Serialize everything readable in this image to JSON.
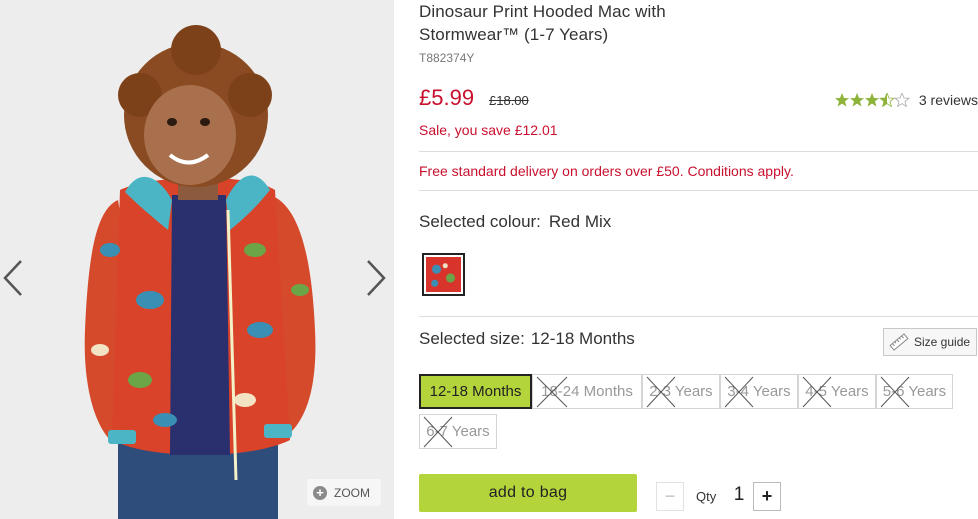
{
  "product": {
    "title": "Dinosaur Print Hooded Mac with Stormwear™ (1-7 Years)",
    "sku": "T882374Y",
    "price": "£5.99",
    "was_price": "£18.00",
    "save_text": "Sale, you save £12.01",
    "rating_value": 3.5,
    "rating_max": 5,
    "reviews_text": "3 reviews"
  },
  "delivery": {
    "text": "Free standard delivery on orders over £50. Conditions apply."
  },
  "colour": {
    "label": "Selected colour:",
    "value": "Red Mix",
    "swatch_icon": "red-mix-dinosaur-swatch"
  },
  "size": {
    "label": "Selected size:",
    "value": "12-18 Months",
    "guide_label": "Size guide",
    "options": [
      {
        "label": "12-18 Months",
        "available": true,
        "selected": true
      },
      {
        "label": "18-24 Months",
        "available": false,
        "selected": false
      },
      {
        "label": "2-3 Years",
        "available": false,
        "selected": false
      },
      {
        "label": "3-4 Years",
        "available": false,
        "selected": false
      },
      {
        "label": "4-5 Years",
        "available": false,
        "selected": false
      },
      {
        "label": "5-6 Years",
        "available": false,
        "selected": false
      },
      {
        "label": "6-7 Years",
        "available": false,
        "selected": false
      }
    ]
  },
  "gallery": {
    "zoom_label": "ZOOM",
    "prev_icon": "chevron-left-icon",
    "next_icon": "chevron-right-icon"
  },
  "actions": {
    "add_to_bag": "add to bag",
    "qty_label": "Qty",
    "qty_value": "1",
    "qty_minus": "−",
    "qty_plus": "+"
  },
  "colors": {
    "price_red": "#c8102e",
    "button_green": "#b4d43c",
    "star_green": "#8db33a"
  }
}
